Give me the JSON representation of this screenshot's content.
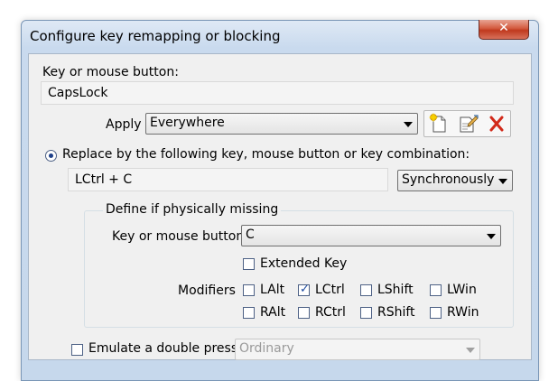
{
  "window": {
    "title": "Configure key remapping or blocking"
  },
  "key_section": {
    "label": "Key or mouse button:",
    "value": "CapsLock"
  },
  "apply": {
    "label": "Apply",
    "selected": "Everywhere"
  },
  "toolbar_icons": [
    "new-document-icon",
    "edit-document-icon",
    "delete-icon"
  ],
  "replace_option": {
    "label": "Replace by the following key, mouse button or key combination:",
    "checked": true,
    "value": "LCtrl + C",
    "sync_selected": "Synchronously"
  },
  "define_group": {
    "title": "Define if physically missing",
    "key_label": "Key or mouse button",
    "key_selected": "C",
    "extended_key": {
      "label": "Extended Key",
      "checked": false
    },
    "modifiers_label": "Modifiers",
    "modifiers": [
      {
        "label": "LAlt",
        "checked": false
      },
      {
        "label": "LCtrl",
        "checked": true
      },
      {
        "label": "LShift",
        "checked": false
      },
      {
        "label": "LWin",
        "checked": false
      },
      {
        "label": "RAlt",
        "checked": false
      },
      {
        "label": "RCtrl",
        "checked": false
      },
      {
        "label": "RShift",
        "checked": false
      },
      {
        "label": "RWin",
        "checked": false
      }
    ]
  },
  "emulate_double": {
    "label": "Emulate a double press:",
    "checked": false,
    "selected": "Ordinary"
  },
  "colors": {
    "title_bar": "#c9daee",
    "close_button": "#c0391e",
    "delete_icon": "#d22a1a"
  }
}
